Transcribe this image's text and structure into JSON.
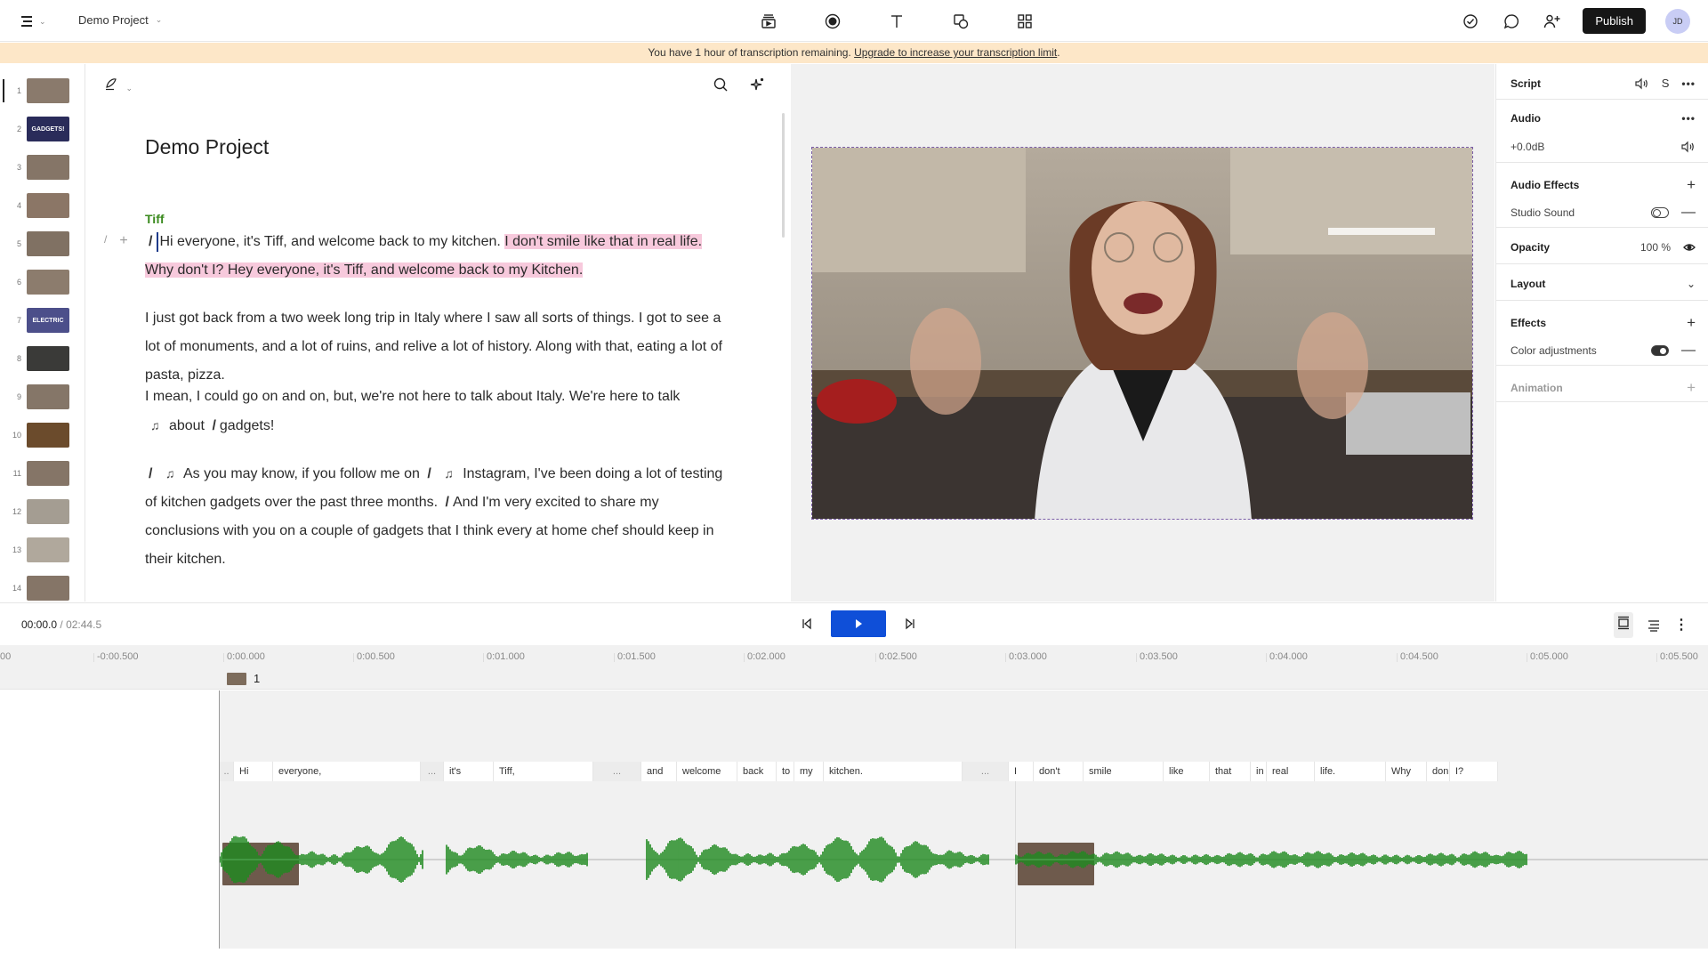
{
  "topbar": {
    "menu_icon": "menu-icon",
    "project_name": "Demo Project",
    "center_tools": [
      "media-icon",
      "record-icon",
      "text-icon",
      "shapes-icon",
      "grid-icon"
    ],
    "right_tools": [
      "check-circle-icon",
      "comment-icon",
      "add-user-icon"
    ],
    "publish_label": "Publish",
    "avatar_initials": "JD"
  },
  "banner": {
    "text": "You have 1 hour of transcription remaining.",
    "link": "Upgrade to increase your transcription limit",
    "suffix": "."
  },
  "scenes": [
    {
      "num": "1",
      "color": "#8a7a6c"
    },
    {
      "num": "2",
      "color": "#2a2c5a",
      "label": "GADGETS!"
    },
    {
      "num": "3",
      "color": "#857567"
    },
    {
      "num": "4",
      "color": "#8b7666"
    },
    {
      "num": "5",
      "color": "#807163"
    },
    {
      "num": "6",
      "color": "#8c7c6d"
    },
    {
      "num": "7",
      "color": "#4c4f8a",
      "label": "ELECTRIC"
    },
    {
      "num": "8",
      "color": "#3a3a38"
    },
    {
      "num": "9",
      "color": "#857668"
    },
    {
      "num": "10",
      "color": "#6b4b2c"
    },
    {
      "num": "11",
      "color": "#857567"
    },
    {
      "num": "12",
      "color": "#a49d92"
    },
    {
      "num": "13",
      "color": "#b0a89c"
    },
    {
      "num": "14",
      "color": "#857567"
    }
  ],
  "editor": {
    "title": "Demo Project",
    "speaker": "Tiff",
    "p1_plain": "Hi everyone, it's Tiff, and welcome back to my kitchen. ",
    "p1_hl1": "I don't smile like that in real life.",
    "p1_hl2": "Why don't I? Hey everyone, it's Tiff, and welcome back to my Kitchen.",
    "p2": "I just got back from a two week long trip in Italy where I saw all sorts of things. I got to see a lot of monuments, and a lot of ruins, and relive a lot of history. Along with that, eating a lot of pasta, pizza.",
    "p3a": "I mean, I could go on and on, but, we're not here to talk about Italy. We're here to talk",
    "p3b": "about",
    "p3c": "gadgets!",
    "p4a": "As you may know, if you follow me on",
    "p4b": "Instagram, I've been doing a lot of testing of kitchen gadgets over the past three months.",
    "p4c": "And I'm very excited to share my conclusions with you on a couple of gadgets that I think every at home chef should keep in their kitchen.",
    "scene_marker": "/",
    "music_marker": "♫"
  },
  "properties": {
    "script": "Script",
    "audio": "Audio",
    "audio_gain": "+0.0dB",
    "audio_effects": "Audio Effects",
    "studio_sound": "Studio Sound",
    "studio_sound_on": false,
    "opacity": "Opacity",
    "opacity_value": "100 %",
    "layout": "Layout",
    "effects": "Effects",
    "color_adjustments": "Color adjustments",
    "color_adjustments_on": true,
    "animation": "Animation"
  },
  "transport": {
    "current": "00:00.0",
    "separator": "/",
    "total": "02:44.5"
  },
  "ruler": [
    "00",
    "-0:00.500",
    "0:00.000",
    "0:00.500",
    "0:01.000",
    "0:01.500",
    "0:02.000",
    "0:02.500",
    "0:03.000",
    "0:03.500",
    "0:04.000",
    "0:04.500",
    "0:05.000",
    "0:05.500"
  ],
  "clip": {
    "label": "1"
  },
  "words": [
    {
      "t": "..",
      "gap": true,
      "w": 16
    },
    {
      "t": "Hi",
      "w": 44
    },
    {
      "t": "everyone,",
      "w": 166
    },
    {
      "t": "...",
      "gap": true,
      "w": 26
    },
    {
      "t": "it's",
      "w": 56
    },
    {
      "t": "Tiff,",
      "w": 112
    },
    {
      "t": "...",
      "gap": true,
      "w": 54
    },
    {
      "t": "and",
      "w": 40
    },
    {
      "t": "welcome",
      "w": 68
    },
    {
      "t": "back",
      "w": 44
    },
    {
      "t": "to",
      "w": 20
    },
    {
      "t": "my",
      "w": 33
    },
    {
      "t": "kitchen.",
      "w": 156
    },
    {
      "t": "...",
      "gap": true,
      "w": 52
    },
    {
      "t": "I",
      "w": 28
    },
    {
      "t": "don't",
      "w": 56
    },
    {
      "t": "smile",
      "w": 90
    },
    {
      "t": "like",
      "w": 52
    },
    {
      "t": "that",
      "w": 46
    },
    {
      "t": "in",
      "w": 18
    },
    {
      "t": "real",
      "w": 54
    },
    {
      "t": "life.",
      "w": 80
    },
    {
      "t": "Why",
      "w": 46
    },
    {
      "t": "don",
      "w": 26
    },
    {
      "t": "I?",
      "w": 54
    }
  ],
  "colors": {
    "accent": "#0f4fd8",
    "waveform": "#1f8a1f",
    "highlight": "#f7c9dc",
    "speaker": "#3a8a1e",
    "banner": "#fde7c8"
  }
}
